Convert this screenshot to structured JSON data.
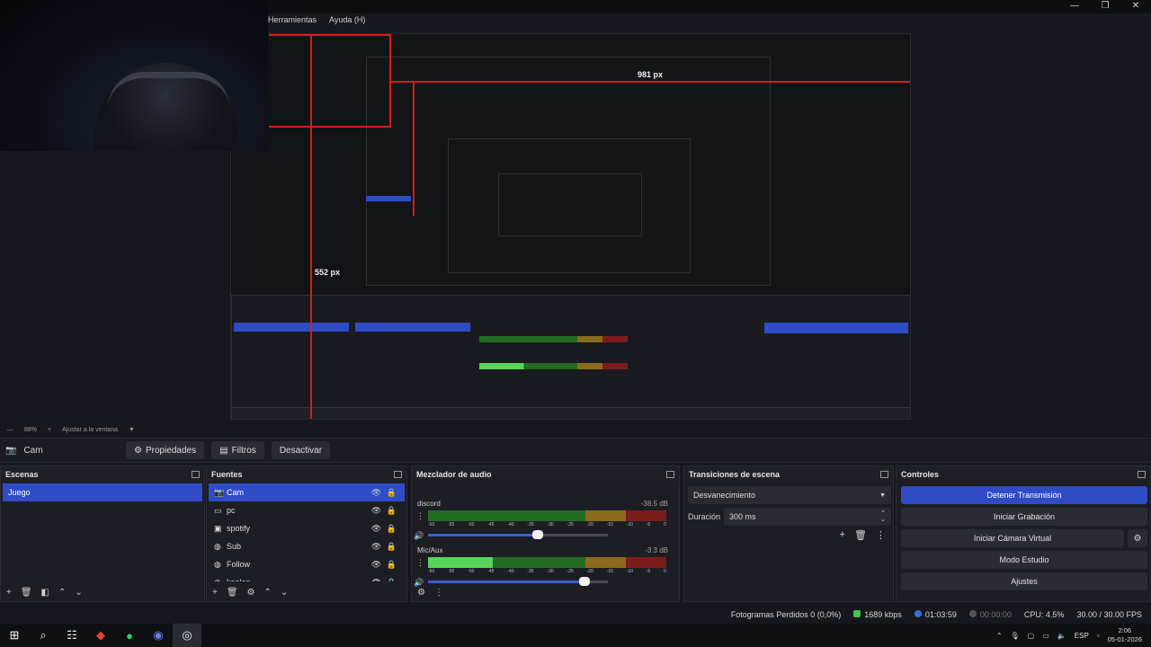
{
  "window": {
    "menu": [
      "Herramientas",
      "Ayuda (H)"
    ],
    "controls": [
      "—",
      "❐",
      "✕"
    ]
  },
  "preview": {
    "measure_labels": [
      "981 px",
      "552 px"
    ]
  },
  "zoom": {
    "level": "88%",
    "fit_label": "Ajustar a la ventana"
  },
  "source_bar": {
    "selected_source": "Cam",
    "buttons": [
      "Propiedades",
      "Filtros",
      "Desactivar"
    ]
  },
  "scenes": {
    "title": "Escenas",
    "items": [
      "Juego"
    ],
    "selected": "Juego"
  },
  "sources": {
    "title": "Fuentes",
    "items": [
      {
        "name": "Cam",
        "icon": "camera-icon"
      },
      {
        "name": "pc",
        "icon": "monitor-icon"
      },
      {
        "name": "spotify",
        "icon": "window-icon"
      },
      {
        "name": "Sub",
        "icon": "globe-icon"
      },
      {
        "name": "Follow",
        "icon": "globe-icon"
      },
      {
        "name": "kaelen",
        "icon": "globe-icon"
      }
    ]
  },
  "mixer": {
    "title": "Mezclador de audio",
    "channels": [
      {
        "name": "discord",
        "db": "-38.5 dB",
        "level": 0.0,
        "volume": 0.61
      },
      {
        "name": "Mic/Aux",
        "db": "-3.3 dB",
        "level": 0.27,
        "volume": 0.87
      }
    ],
    "ticks": [
      "-60",
      "-55",
      "-50",
      "-45",
      "-40",
      "-35",
      "-30",
      "-25",
      "-20",
      "-15",
      "-10",
      "-5",
      "0"
    ]
  },
  "transitions": {
    "title": "Transiciones de escena",
    "selected": "Desvanecimiento",
    "duration_label": "Duración",
    "duration_value": "300 ms"
  },
  "controls": {
    "title": "Controles",
    "buttons": [
      "Detener Transmisión",
      "Iniciar Grabación",
      "Iniciar Cámara Virtual",
      "Modo Estudio",
      "Ajustes"
    ]
  },
  "status": {
    "dropped": "Fotogramas Perdidos 0 (0,0%)",
    "bitrate": "1689 kbps",
    "stream_time": "01:03:59",
    "rec_time": "00:00:00",
    "cpu": "CPU: 4.5%",
    "fps": "30.00 / 30.00 FPS"
  },
  "taskbar": {
    "lang": "ESP",
    "time": "2:06",
    "date": "05-01-2026"
  },
  "colors": {
    "accent": "#2f4cc6",
    "measure_line": "#d0201e",
    "meter_green": "#58d458"
  }
}
